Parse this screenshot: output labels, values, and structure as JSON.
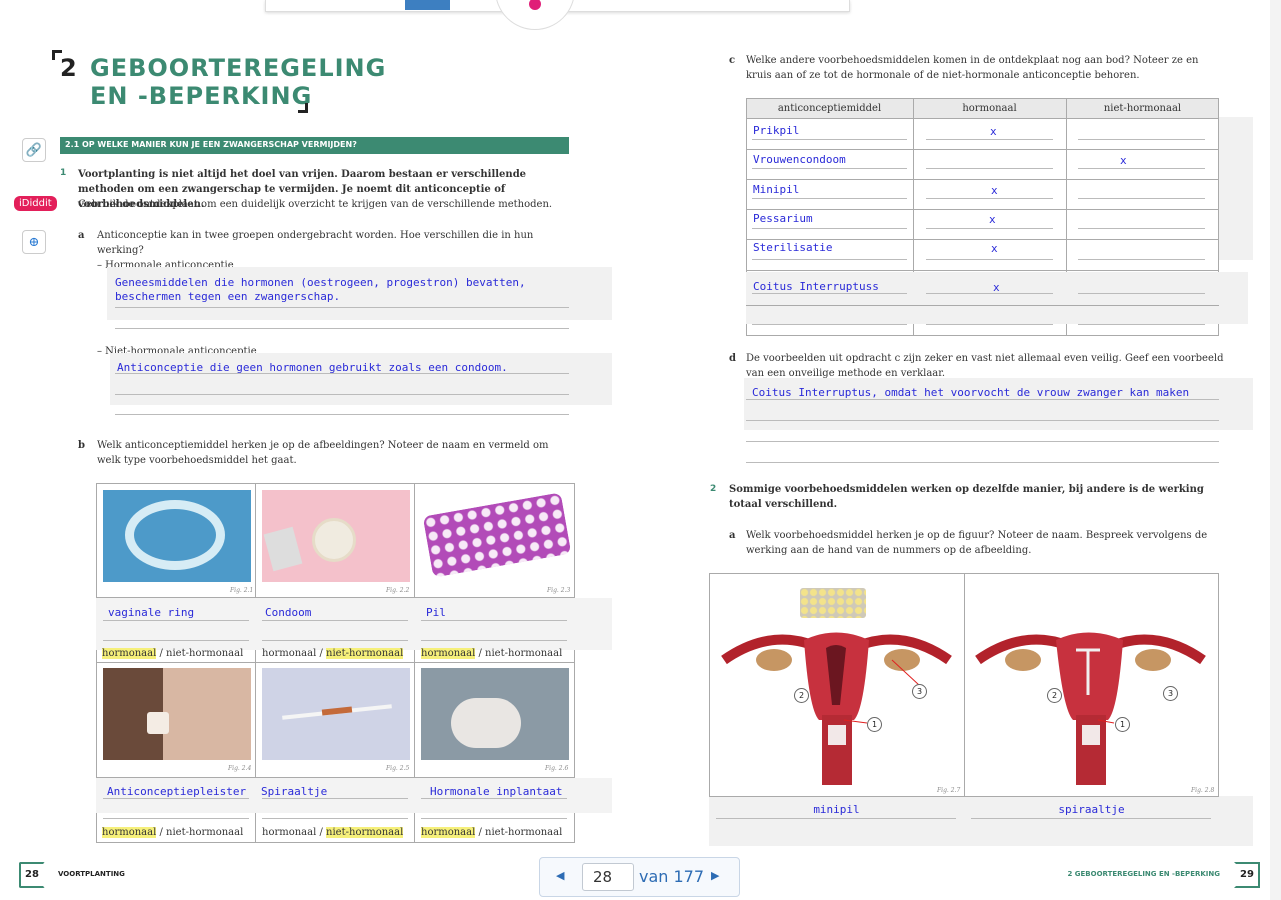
{
  "left": {
    "chapter_num": "2",
    "title1": "GEBOORTEREGELING",
    "title2": "EN -BEPERKING",
    "section_bar": "2.1   OP WELKE MANIER KUN JE EEN ZWANGERSCHAP VERMIJDEN?",
    "q1_num": "1",
    "q1_bold": "Voortplanting is niet altijd het doel van vrijen. Daarom bestaan er verschillende methoden om een zwangerschap te vermijden. Je noemt dit anticonceptie of voorbehoedsmiddelen.",
    "q1_sub": "Gebruik de ontdekplaat om een duidelijk overzicht te krijgen van de verschillende methoden.",
    "qa_letter": "a",
    "qa_text": "Anticonceptie kan in twee groepen ondergebracht worden. Hoe verschillen die in hun werking?",
    "hormonal_label": "–   Hormonale anticonceptie",
    "hormonal_answer": "Geneesmiddelen die hormonen (oestrogeen, progestron) bevatten, beschermen tegen een zwangerschap.",
    "nonhormonal_label": "–   Niet-hormonale anticonceptie",
    "nonhormonal_answer": "Anticonceptie die geen hormonen gebruikt zoals een condoom.",
    "qb_letter": "b",
    "qb_text": "Welk anticonceptiemiddel herken je op de afbeeldingen? Noteer de naam en vermeld om welk type voorbehoedsmiddel het gaat.",
    "figures": [
      {
        "fig": "Fig. 2.1",
        "answer": "vaginale ring",
        "hormonal": "hormonaal",
        "sep": " / ",
        "nonhormonal": "niet-hormonaal",
        "marked": "hormonaal"
      },
      {
        "fig": "Fig. 2.2",
        "answer": "Condoom",
        "hormonal": "hormonaal",
        "sep": " / ",
        "nonhormonal": "niet-hormonaal",
        "marked": "niet-hormonaal"
      },
      {
        "fig": "Fig. 2.3",
        "answer": "Pil",
        "hormonal": "hormonaal",
        "sep": " / ",
        "nonhormonal": "niet-hormonaal",
        "marked": "hormonaal"
      },
      {
        "fig": "Fig. 2.4",
        "answer": "Anticonceptiepleister",
        "hormonal": "hormonaal",
        "sep": " / ",
        "nonhormonal": "niet-hormonaal",
        "marked": "hormonaal"
      },
      {
        "fig": "Fig. 2.5",
        "answer": "Spiraaltje",
        "hormonal": "hormonaal",
        "sep": " / ",
        "nonhormonal": "niet-hormonaal",
        "marked": "niet-hormonaal"
      },
      {
        "fig": "Fig. 2.6",
        "answer": "Hormonale inplantaat",
        "hormonal": "hormonaal",
        "sep": " / ",
        "nonhormonal": "niet-hormonaal",
        "marked": "hormonaal"
      }
    ],
    "footer_page": "28",
    "footer_label": "VOORTPLANTING",
    "ididdit": "iDiddit"
  },
  "right": {
    "qc_letter": "c",
    "qc_text": "Welke andere voorbehoedsmiddelen komen in de ontdekplaat nog aan bod? Noteer ze en kruis aan of ze tot de hormonale of de niet-hormonale anticonceptie behoren.",
    "table_headers": [
      "anticonceptiemiddel",
      "hormonaal",
      "niet-hormonaal"
    ],
    "rows": [
      {
        "name": "Prikpil",
        "h": "x",
        "n": ""
      },
      {
        "name": "Vrouwencondoom",
        "h": "",
        "n": "x"
      },
      {
        "name": "Minipil",
        "h": "x",
        "n": ""
      },
      {
        "name": "Pessarium",
        "h": "x",
        "n": ""
      },
      {
        "name": "Sterilisatie",
        "h": "x",
        "n": ""
      },
      {
        "name": "Coitus Interruptuss",
        "h": "x",
        "n": ""
      },
      {
        "name": "",
        "h": "",
        "n": ""
      }
    ],
    "qd_letter": "d",
    "qd_text": "De voorbeelden uit opdracht c zijn zeker en vast niet allemaal even veilig. Geef een voorbeeld van een onveilige methode en verklaar.",
    "qd_answer": "Coitus Interruptus, omdat het voorvocht de vrouw zwanger kan maken",
    "q2_num": "2",
    "q2_bold": "Sommige voorbehoedsmiddelen werken op dezelfde manier, bij andere is de werking totaal verschillend.",
    "q2a_letter": "a",
    "q2a_text": "Welk voorbehoedsmiddel herken je op de figuur? Noteer de naam. Bespreek vervolgens de werking aan de hand van de nummers op de afbeelding.",
    "fig7": "Fig. 2.7",
    "fig8": "Fig. 2.8",
    "ans7": "minipil",
    "ans8": "spiraaltje",
    "callouts": [
      "1",
      "2",
      "3"
    ],
    "footer_label": "2 GEBOORTEREGELING EN -BEPERKING",
    "footer_page": "29"
  },
  "pager": {
    "current": "28",
    "total_label": "van 177"
  },
  "colors": {
    "accent": "#3c8a72",
    "answer": "#2a2ad8",
    "highlight": "#f6f07a"
  }
}
